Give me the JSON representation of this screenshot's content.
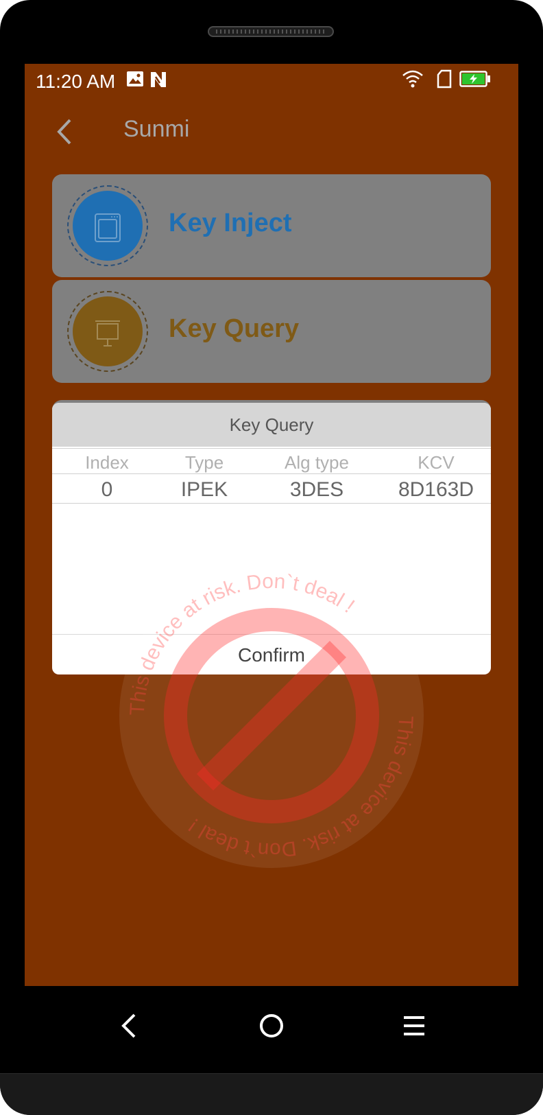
{
  "status_bar": {
    "time": "11:20 AM",
    "icons": [
      "image-icon",
      "n-app-icon",
      "wifi-icon",
      "sim-card-icon",
      "battery-charging-icon"
    ],
    "battery_color": "#2ec42e"
  },
  "header": {
    "back_icon": "chevron-left-icon",
    "title": "Sunmi"
  },
  "menu": {
    "items": [
      {
        "label": "Key Inject",
        "icon": "window-icon",
        "color": "#1f6fb3"
      },
      {
        "label": "Key Query",
        "icon": "presentation-board-icon",
        "color": "#7f5a16"
      }
    ]
  },
  "dialog": {
    "title": "Key Query",
    "columns": [
      "Index",
      "Type",
      "Alg type",
      "KCV"
    ],
    "rows": [
      [
        "0",
        "IPEK",
        "3DES",
        "8D163D"
      ]
    ],
    "confirm_label": "Confirm"
  },
  "watermark": {
    "text_top": "This device at risk. Don`t deal !",
    "text_bottom": "This device at risk. Don`t deal !",
    "color": "#ff4a4a"
  },
  "nav_bar": {
    "icons": [
      "back-icon",
      "home-icon",
      "menu-icon"
    ]
  },
  "colors": {
    "screen_bg": "#7f3200",
    "card_bg": "#808080"
  }
}
